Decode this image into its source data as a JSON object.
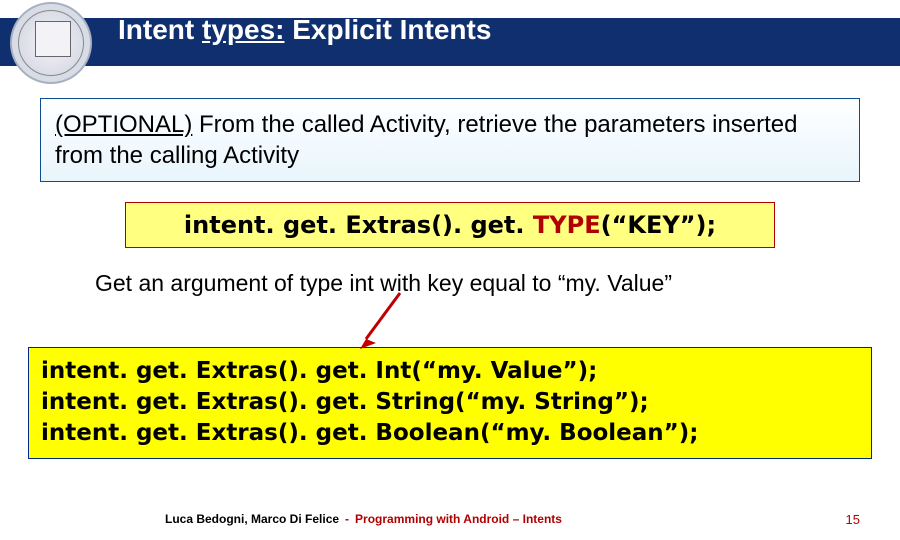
{
  "header": {
    "title_prefix": "Intent ",
    "title_underlined": "types:",
    "title_suffix": " Explicit Intents"
  },
  "infobox": {
    "optional_label": "(OPTIONAL)",
    "text_mid1": " From the called Activity, ",
    "retrieve_word": "retrieve",
    "text_mid2": " the ",
    "params_word": "parameters",
    "text_end": " inserted from the calling Activity"
  },
  "code1": {
    "prefix": "intent. get. Extras(). get. ",
    "type": "TYPE",
    "suffix": "(“KEY”);"
  },
  "desc": "Get an argument of type int with key equal to “my. Value”",
  "code2": {
    "line1": "intent. get. Extras(). get. Int(“my. Value”);",
    "line2": "intent. get. Extras(). get. String(“my. String”);",
    "line3": "intent. get. Extras(). get. Boolean(“my. Boolean”);"
  },
  "footer": {
    "authors": "Luca Bedogni, Marco Di Felice",
    "sep": "-",
    "topic": "Programming with Android – Intents",
    "page": "15"
  }
}
